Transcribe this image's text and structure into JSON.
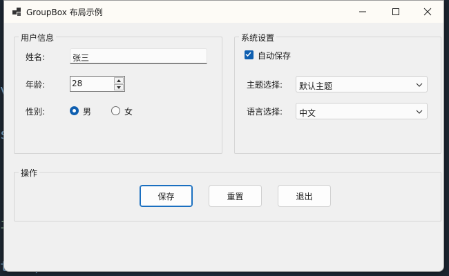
{
  "window": {
    "title": "GroupBox 布局示例"
  },
  "user_group": {
    "label": "用户信息",
    "name_label": "姓名:",
    "name_value": "张三",
    "age_label": "年龄:",
    "age_value": "28",
    "gender_label": "性别:",
    "gender_options": [
      {
        "label": "男",
        "selected": true
      },
      {
        "label": "女",
        "selected": false
      }
    ]
  },
  "system_group": {
    "label": "系统设置",
    "autosave_label": "自动保存",
    "autosave_checked": true,
    "theme_label": "主题选择:",
    "theme_value": "默认主题",
    "language_label": "语言选择:",
    "language_value": "中文"
  },
  "actions_group": {
    "label": "操作",
    "save_label": "保存",
    "reset_label": "重置",
    "exit_label": "退出"
  },
  "colors": {
    "accent": "#0f5fb0",
    "window_bg": "#f0f0f0",
    "titlebar_bg": "#fdfbf6"
  },
  "icons": [
    "app-icon",
    "minimize-icon",
    "maximize-icon",
    "close-icon",
    "checkmark-icon",
    "spin-up-icon",
    "spin-down-icon",
    "chevron-down-icon"
  ]
}
